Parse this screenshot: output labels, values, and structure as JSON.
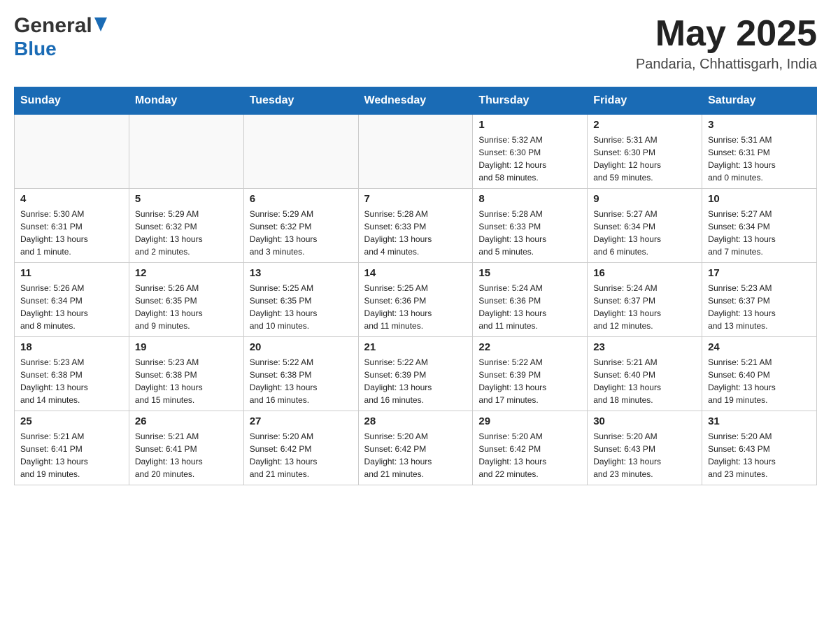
{
  "header": {
    "logo_general": "General",
    "logo_blue": "Blue",
    "month_title": "May 2025",
    "location": "Pandaria, Chhattisgarh, India"
  },
  "days_of_week": [
    "Sunday",
    "Monday",
    "Tuesday",
    "Wednesday",
    "Thursday",
    "Friday",
    "Saturday"
  ],
  "weeks": [
    [
      {
        "day": "",
        "info": ""
      },
      {
        "day": "",
        "info": ""
      },
      {
        "day": "",
        "info": ""
      },
      {
        "day": "",
        "info": ""
      },
      {
        "day": "1",
        "info": "Sunrise: 5:32 AM\nSunset: 6:30 PM\nDaylight: 12 hours\nand 58 minutes."
      },
      {
        "day": "2",
        "info": "Sunrise: 5:31 AM\nSunset: 6:30 PM\nDaylight: 12 hours\nand 59 minutes."
      },
      {
        "day": "3",
        "info": "Sunrise: 5:31 AM\nSunset: 6:31 PM\nDaylight: 13 hours\nand 0 minutes."
      }
    ],
    [
      {
        "day": "4",
        "info": "Sunrise: 5:30 AM\nSunset: 6:31 PM\nDaylight: 13 hours\nand 1 minute."
      },
      {
        "day": "5",
        "info": "Sunrise: 5:29 AM\nSunset: 6:32 PM\nDaylight: 13 hours\nand 2 minutes."
      },
      {
        "day": "6",
        "info": "Sunrise: 5:29 AM\nSunset: 6:32 PM\nDaylight: 13 hours\nand 3 minutes."
      },
      {
        "day": "7",
        "info": "Sunrise: 5:28 AM\nSunset: 6:33 PM\nDaylight: 13 hours\nand 4 minutes."
      },
      {
        "day": "8",
        "info": "Sunrise: 5:28 AM\nSunset: 6:33 PM\nDaylight: 13 hours\nand 5 minutes."
      },
      {
        "day": "9",
        "info": "Sunrise: 5:27 AM\nSunset: 6:34 PM\nDaylight: 13 hours\nand 6 minutes."
      },
      {
        "day": "10",
        "info": "Sunrise: 5:27 AM\nSunset: 6:34 PM\nDaylight: 13 hours\nand 7 minutes."
      }
    ],
    [
      {
        "day": "11",
        "info": "Sunrise: 5:26 AM\nSunset: 6:34 PM\nDaylight: 13 hours\nand 8 minutes."
      },
      {
        "day": "12",
        "info": "Sunrise: 5:26 AM\nSunset: 6:35 PM\nDaylight: 13 hours\nand 9 minutes."
      },
      {
        "day": "13",
        "info": "Sunrise: 5:25 AM\nSunset: 6:35 PM\nDaylight: 13 hours\nand 10 minutes."
      },
      {
        "day": "14",
        "info": "Sunrise: 5:25 AM\nSunset: 6:36 PM\nDaylight: 13 hours\nand 11 minutes."
      },
      {
        "day": "15",
        "info": "Sunrise: 5:24 AM\nSunset: 6:36 PM\nDaylight: 13 hours\nand 11 minutes."
      },
      {
        "day": "16",
        "info": "Sunrise: 5:24 AM\nSunset: 6:37 PM\nDaylight: 13 hours\nand 12 minutes."
      },
      {
        "day": "17",
        "info": "Sunrise: 5:23 AM\nSunset: 6:37 PM\nDaylight: 13 hours\nand 13 minutes."
      }
    ],
    [
      {
        "day": "18",
        "info": "Sunrise: 5:23 AM\nSunset: 6:38 PM\nDaylight: 13 hours\nand 14 minutes."
      },
      {
        "day": "19",
        "info": "Sunrise: 5:23 AM\nSunset: 6:38 PM\nDaylight: 13 hours\nand 15 minutes."
      },
      {
        "day": "20",
        "info": "Sunrise: 5:22 AM\nSunset: 6:38 PM\nDaylight: 13 hours\nand 16 minutes."
      },
      {
        "day": "21",
        "info": "Sunrise: 5:22 AM\nSunset: 6:39 PM\nDaylight: 13 hours\nand 16 minutes."
      },
      {
        "day": "22",
        "info": "Sunrise: 5:22 AM\nSunset: 6:39 PM\nDaylight: 13 hours\nand 17 minutes."
      },
      {
        "day": "23",
        "info": "Sunrise: 5:21 AM\nSunset: 6:40 PM\nDaylight: 13 hours\nand 18 minutes."
      },
      {
        "day": "24",
        "info": "Sunrise: 5:21 AM\nSunset: 6:40 PM\nDaylight: 13 hours\nand 19 minutes."
      }
    ],
    [
      {
        "day": "25",
        "info": "Sunrise: 5:21 AM\nSunset: 6:41 PM\nDaylight: 13 hours\nand 19 minutes."
      },
      {
        "day": "26",
        "info": "Sunrise: 5:21 AM\nSunset: 6:41 PM\nDaylight: 13 hours\nand 20 minutes."
      },
      {
        "day": "27",
        "info": "Sunrise: 5:20 AM\nSunset: 6:42 PM\nDaylight: 13 hours\nand 21 minutes."
      },
      {
        "day": "28",
        "info": "Sunrise: 5:20 AM\nSunset: 6:42 PM\nDaylight: 13 hours\nand 21 minutes."
      },
      {
        "day": "29",
        "info": "Sunrise: 5:20 AM\nSunset: 6:42 PM\nDaylight: 13 hours\nand 22 minutes."
      },
      {
        "day": "30",
        "info": "Sunrise: 5:20 AM\nSunset: 6:43 PM\nDaylight: 13 hours\nand 23 minutes."
      },
      {
        "day": "31",
        "info": "Sunrise: 5:20 AM\nSunset: 6:43 PM\nDaylight: 13 hours\nand 23 minutes."
      }
    ]
  ]
}
